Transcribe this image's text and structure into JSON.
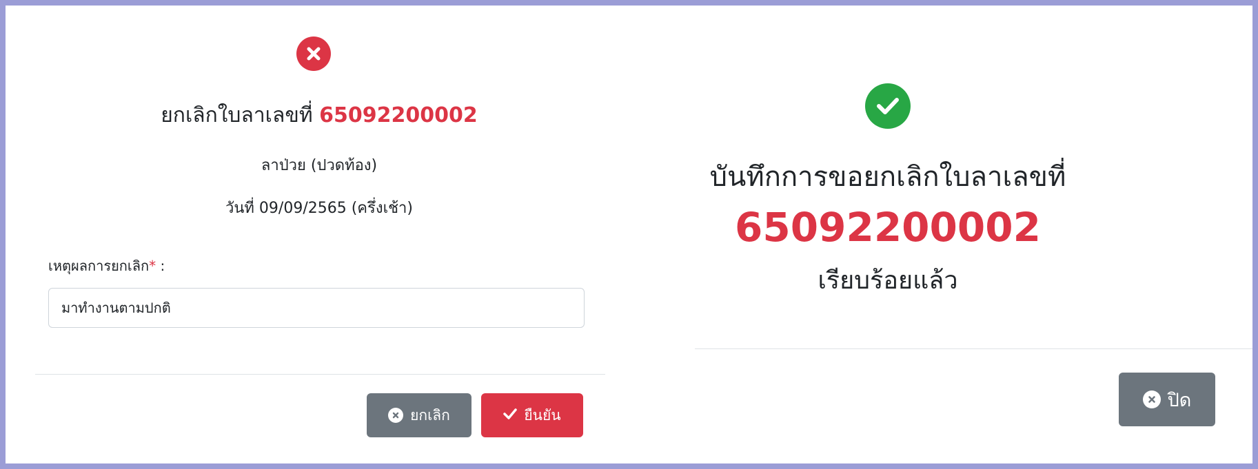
{
  "colors": {
    "danger": "#dc3545",
    "success": "#28a745",
    "secondary": "#6c757d",
    "page_border": "#9b9dd6"
  },
  "cancel_dialog": {
    "status_icon": "times-circle-icon",
    "title_prefix": "ยกเลิกใบลาเลขที่",
    "leave_number": "65092200002",
    "leave_type": "ลาป่วย (ปวดท้อง)",
    "leave_date": "วันที่ 09/09/2565 (ครึ่งเช้า)",
    "reason_label": "เหตุผลการยกเลิก",
    "required_mark": "*",
    "label_suffix": " :",
    "reason_value": "มาทำงานตามปกติ",
    "cancel_button": {
      "label": "ยกเลิก",
      "icon": "times-circle-icon"
    },
    "confirm_button": {
      "label": "ยืนยัน",
      "icon": "check-icon"
    }
  },
  "success_dialog": {
    "status_icon": "check-circle-icon",
    "title": "บันทึกการขอยกเลิกใบลาเลขที่",
    "leave_number": "65092200002",
    "status_text": "เรียบร้อยแล้ว",
    "close_button": {
      "label": "ปิด",
      "icon": "times-circle-icon"
    }
  }
}
